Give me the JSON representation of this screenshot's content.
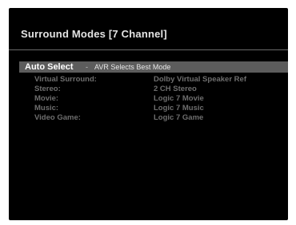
{
  "menu": {
    "title": "Surround Modes [7 Channel]",
    "selected": {
      "label": "Auto Select",
      "separator": "-",
      "description": "AVR Selects Best Mode"
    },
    "rows": [
      {
        "label": "Virtual Surround:",
        "value": "Dolby Virtual Speaker Ref"
      },
      {
        "label": "Stereo:",
        "value": "2 CH Stereo"
      },
      {
        "label": "Movie:",
        "value": "Logic 7 Movie"
      },
      {
        "label": "Music:",
        "value": "Logic 7 Music"
      },
      {
        "label": "Video Game:",
        "value": "Logic 7 Game"
      }
    ]
  },
  "colors": {
    "screen_background": "#000000",
    "highlight_bar": "#5c5c5c",
    "title_text": "#e4e4e4",
    "inactive_text": "#6e6e6e"
  }
}
